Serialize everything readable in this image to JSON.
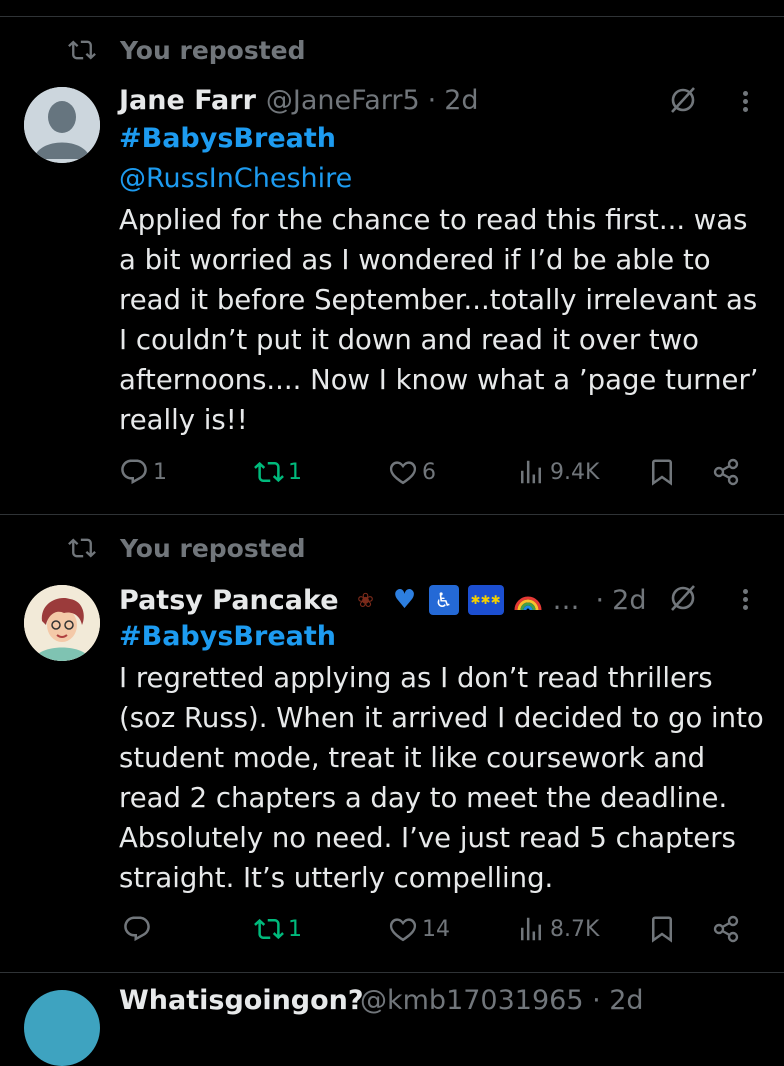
{
  "tweets": [
    {
      "repost_label": "You reposted",
      "name": "Jane Farr",
      "handle": "@JaneFarr5",
      "dot": "·",
      "time": "2d",
      "hashtag": "#BabysBreath",
      "mention": "@RussInCheshire",
      "text": "Applied for the chance to read this  first... was\na bit worried as I wondered if I’d be able to\nread it before September...totally irrelevant as\nI couldn’t put it down and read it over two\nafternoons.... Now I know what a ’page turner’\nreally is!!",
      "replies": "1",
      "reposts": "1",
      "likes": "6",
      "views": "9.4K"
    },
    {
      "repost_label": "You reposted",
      "name": "Patsy Pancake",
      "emoji_badges": [
        "wilted-rose",
        "blue-heart",
        "wheelchair-symbol",
        "eu-flag",
        "rainbow"
      ],
      "ellipsis": "…",
      "dot": "·",
      "time": "2d",
      "hashtag": "#BabysBreath",
      "text": "I regretted applying as I don’t read thrillers\n(soz Russ). When  it arrived I decided to go into\nstudent mode, treat it like coursework and\nread 2 chapters a day to meet the deadline.\nAbsolutely no need. I’ve just read 5 chapters\nstraight. It’s utterly compelling.",
      "replies": "",
      "reposts": "1",
      "likes": "14",
      "views": "8.7K"
    }
  ],
  "next_tweet": {
    "name": "Whatisgoingon?",
    "handle": "@kmb17031965 · 2d"
  },
  "colors": {
    "background": "#000000",
    "text": "#e7e9ea",
    "muted": "#71767b",
    "link": "#1d9bf0",
    "repost_active": "#00ba7c"
  }
}
